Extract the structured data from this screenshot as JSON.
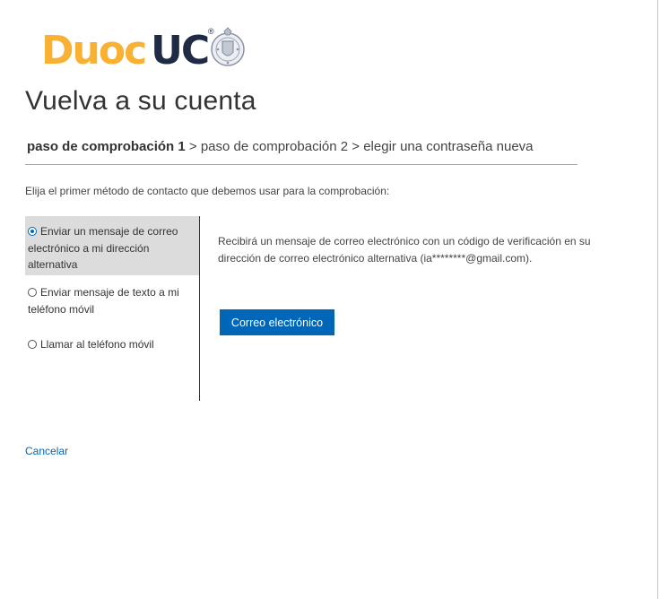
{
  "brand": {
    "logo_part1": "Duoc",
    "logo_part2": "UC",
    "logo_registered": "®",
    "color_duoc": "#f8b133",
    "color_uc": "#1f2a44",
    "seal_icon": "university-seal-icon"
  },
  "page": {
    "title": "Vuelva a su cuenta"
  },
  "steps": {
    "current": "paso de comprobación 1",
    "separator": " > ",
    "step2": "paso de comprobación 2",
    "step3": "elegir una contraseña nueva"
  },
  "instruction": "Elija el primer método de contacto que debemos usar para la comprobación:",
  "contact_methods": [
    {
      "label": "Enviar un mensaje de correo electrónico a mi dirección alternativa",
      "selected": true
    },
    {
      "label": "Enviar mensaje de texto a mi teléfono móvil",
      "selected": false
    },
    {
      "label": "Llamar al teléfono móvil",
      "selected": false
    }
  ],
  "detail": {
    "description": "Recibirá un mensaje de correo electrónico con un código de verificación en su dirección de correo electrónico alternativa (ia********@gmail.com).",
    "button_label": "Correo electrónico"
  },
  "cancel_label": "Cancelar",
  "colors": {
    "accent": "#0067b8",
    "selected_bg": "#dcdcdc"
  }
}
